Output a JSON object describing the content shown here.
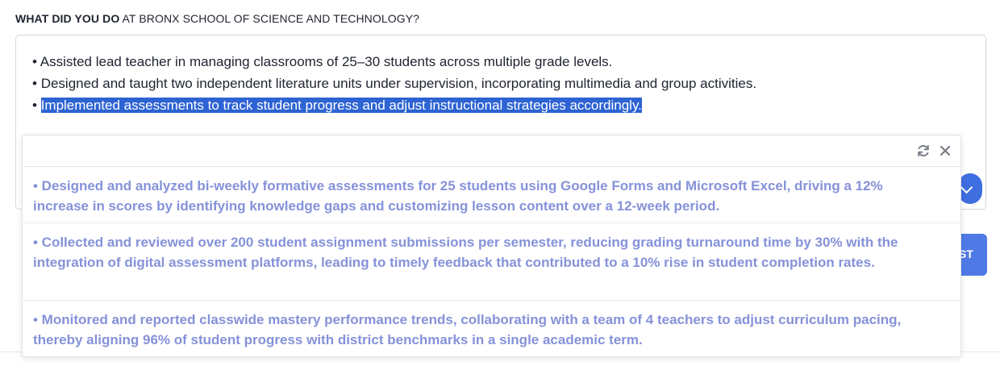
{
  "question": {
    "bold": "WHAT DID YOU DO",
    "rest": " AT BRONX SCHOOL OF SCIENCE AND TECHNOLOGY?"
  },
  "editor": {
    "lines": [
      {
        "bullet": "• ",
        "text": "Assisted lead teacher in managing classrooms of 25–30 students across multiple grade levels."
      },
      {
        "bullet": "• ",
        "text": "Designed and taught two independent literature units under supervision, incorporating multimedia and group activities."
      },
      {
        "bullet": "• ",
        "text": "Implemented assessments to track student progress and adjust instructional strategies accordingly."
      }
    ]
  },
  "partial_button": {
    "label": "ST"
  },
  "popup": {
    "suggestions": [
      {
        "text": "• Designed and analyzed bi-weekly formative assessments for 25 students using Google Forms and Microsoft Excel, driving a 12% increase in scores by identifying knowledge gaps and customizing lesson content over a 12-week period."
      },
      {
        "text": "• Collected and reviewed over 200 student assignment submissions per semester, reducing grading turnaround time by 30% with the integration of digital assessment platforms, leading to timely feedback that contributed to a 10% rise in student completion rates."
      },
      {
        "text": "• Monitored and reported classwide mastery performance trends, collaborating with a team of 4 teachers to adjust curriculum pacing, thereby aligning 96% of student progress with district benchmarks in a single academic term."
      }
    ],
    "icons": {
      "refresh": "refresh-icon",
      "close": "close-icon"
    }
  },
  "colors": {
    "highlight": "#2d63d2",
    "suggestion_text": "#8592d9",
    "accent": "#3f6ee0"
  }
}
